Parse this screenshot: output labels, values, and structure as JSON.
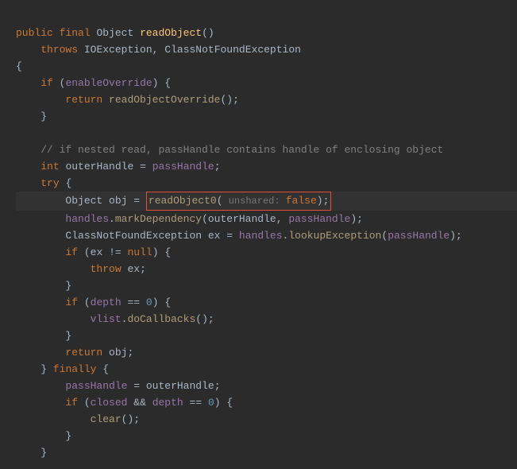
{
  "code": {
    "l1_public": "public",
    "l1_final": "final",
    "l1_type": "Object",
    "l1_method": "readObject",
    "l1_parens": "()",
    "l2_throws": "throws",
    "l2_ex1": "IOException",
    "l2_comma": ",",
    "l2_ex2": "ClassNotFoundException",
    "l3_brace": "{",
    "l4_if": "if",
    "l4_lp": "(",
    "l4_cond": "enableOverride",
    "l4_rp": ")",
    "l4_brace": "{",
    "l5_return": "return",
    "l5_call": "readObjectOverride",
    "l5_parens": "()",
    "l5_semi": ";",
    "l6_brace": "}",
    "l8_comment": "// if nested read, passHandle contains handle of enclosing object",
    "l9_int": "int",
    "l9_var": "outerHandle",
    "l9_eq": "=",
    "l9_field": "passHandle",
    "l9_semi": ";",
    "l10_try": "try",
    "l10_brace": "{",
    "l11_type": "Object",
    "l11_var": "obj",
    "l11_eq": "=",
    "l11_call": "readObject0",
    "l11_lp": "(",
    "l11_hint": " unshared: ",
    "l11_false": "false",
    "l11_rp": ")",
    "l11_semi": ";",
    "l12_field": "handles",
    "l12_dot": ".",
    "l12_call": "markDependency",
    "l12_lp": "(",
    "l12_arg1": "outerHandle",
    "l12_comma": ",",
    "l12_arg2": "passHandle",
    "l12_rp": ")",
    "l12_semi": ";",
    "l13_type": "ClassNotFoundException",
    "l13_var": "ex",
    "l13_eq": "=",
    "l13_field": "handles",
    "l13_dot": ".",
    "l13_call": "lookupException",
    "l13_lp": "(",
    "l13_arg": "passHandle",
    "l13_rp": ")",
    "l13_semi": ";",
    "l14_if": "if",
    "l14_lp": "(",
    "l14_var": "ex",
    "l14_op": "!=",
    "l14_null": "null",
    "l14_rp": ")",
    "l14_brace": "{",
    "l15_throw": "throw",
    "l15_var": "ex",
    "l15_semi": ";",
    "l16_brace": "}",
    "l17_if": "if",
    "l17_lp": "(",
    "l17_field": "depth",
    "l17_op": "==",
    "l17_num": "0",
    "l17_rp": ")",
    "l17_brace": "{",
    "l18_field": "vlist",
    "l18_dot": ".",
    "l18_call": "doCallbacks",
    "l18_parens": "()",
    "l18_semi": ";",
    "l19_brace": "}",
    "l20_return": "return",
    "l20_var": "obj",
    "l20_semi": ";",
    "l21_brace": "}",
    "l21_finally": "finally",
    "l21_brace2": "{",
    "l22_field": "passHandle",
    "l22_eq": "=",
    "l22_var": "outerHandle",
    "l22_semi": ";",
    "l23_if": "if",
    "l23_lp": "(",
    "l23_field1": "closed",
    "l23_and": "&&",
    "l23_field2": "depth",
    "l23_op": "==",
    "l23_num": "0",
    "l23_rp": ")",
    "l23_brace": "{",
    "l24_call": "clear",
    "l24_parens": "()",
    "l24_semi": ";",
    "l25_brace": "}",
    "l26_brace": "}"
  }
}
